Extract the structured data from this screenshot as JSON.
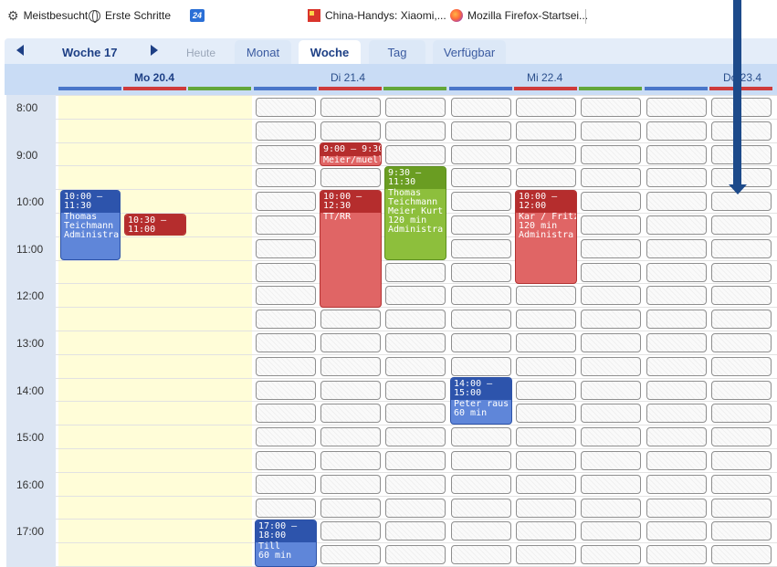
{
  "bookmarks": {
    "items": [
      {
        "label": "Meistbesucht",
        "icon": "gear-icon"
      },
      {
        "label": "Erste Schritte",
        "icon": "globe-icon"
      },
      {
        "label": "",
        "icon": "24-badge-icon"
      },
      {
        "label": "China-Handys: Xiaomi,...",
        "icon": "china-flag-icon"
      },
      {
        "label": "Mozilla Firefox-Startsei...",
        "icon": "firefox-icon"
      }
    ]
  },
  "calendar": {
    "week_label": "Woche 17",
    "today_label": "Heute",
    "tabs": [
      {
        "label": "Monat",
        "active": false
      },
      {
        "label": "Woche",
        "active": true
      },
      {
        "label": "Tag",
        "active": false
      },
      {
        "label": "Verfügbar",
        "active": false
      }
    ],
    "days": [
      {
        "label": "Mo 20.4",
        "bold": true
      },
      {
        "label": "Di 21.4",
        "bold": false
      },
      {
        "label": "Mi 22.4",
        "bold": false
      },
      {
        "label": "Do 23.4",
        "bold": false
      }
    ],
    "resource_colors": [
      "#4a76c9",
      "#cf3b3b",
      "#63a73a"
    ],
    "times": [
      "8:00",
      "9:00",
      "10:00",
      "11:00",
      "12:00",
      "13:00",
      "14:00",
      "15:00",
      "16:00",
      "17:00"
    ],
    "events": [
      {
        "time": "10:00 –\n11:30",
        "body": "Thomas\nTeichmann\nAdministra",
        "color": "blue"
      },
      {
        "time": "10:30 –\n11:00",
        "body": "",
        "color": "red"
      },
      {
        "time": "9:00 – 9:30",
        "body": "Meier/muell",
        "color": "red"
      },
      {
        "time": "10:00 –\n12:30",
        "body": "TT/RR",
        "color": "red"
      },
      {
        "time": "9:30 –\n11:30",
        "body": "Thomas\nTeichmann\nMeier Kurt\n120 min\nAdministra",
        "color": "green"
      },
      {
        "time": "10:00 –\n12:00",
        "body": "Kar / Fritz\n120 min\nAdministra",
        "color": "red"
      },
      {
        "time": "14:00 –\n15:00",
        "body": "Peter raus\n60 min",
        "color": "blue"
      },
      {
        "time": "17:00 –\n18:00",
        "body": "Till\n60 min",
        "color": "blue"
      }
    ]
  }
}
